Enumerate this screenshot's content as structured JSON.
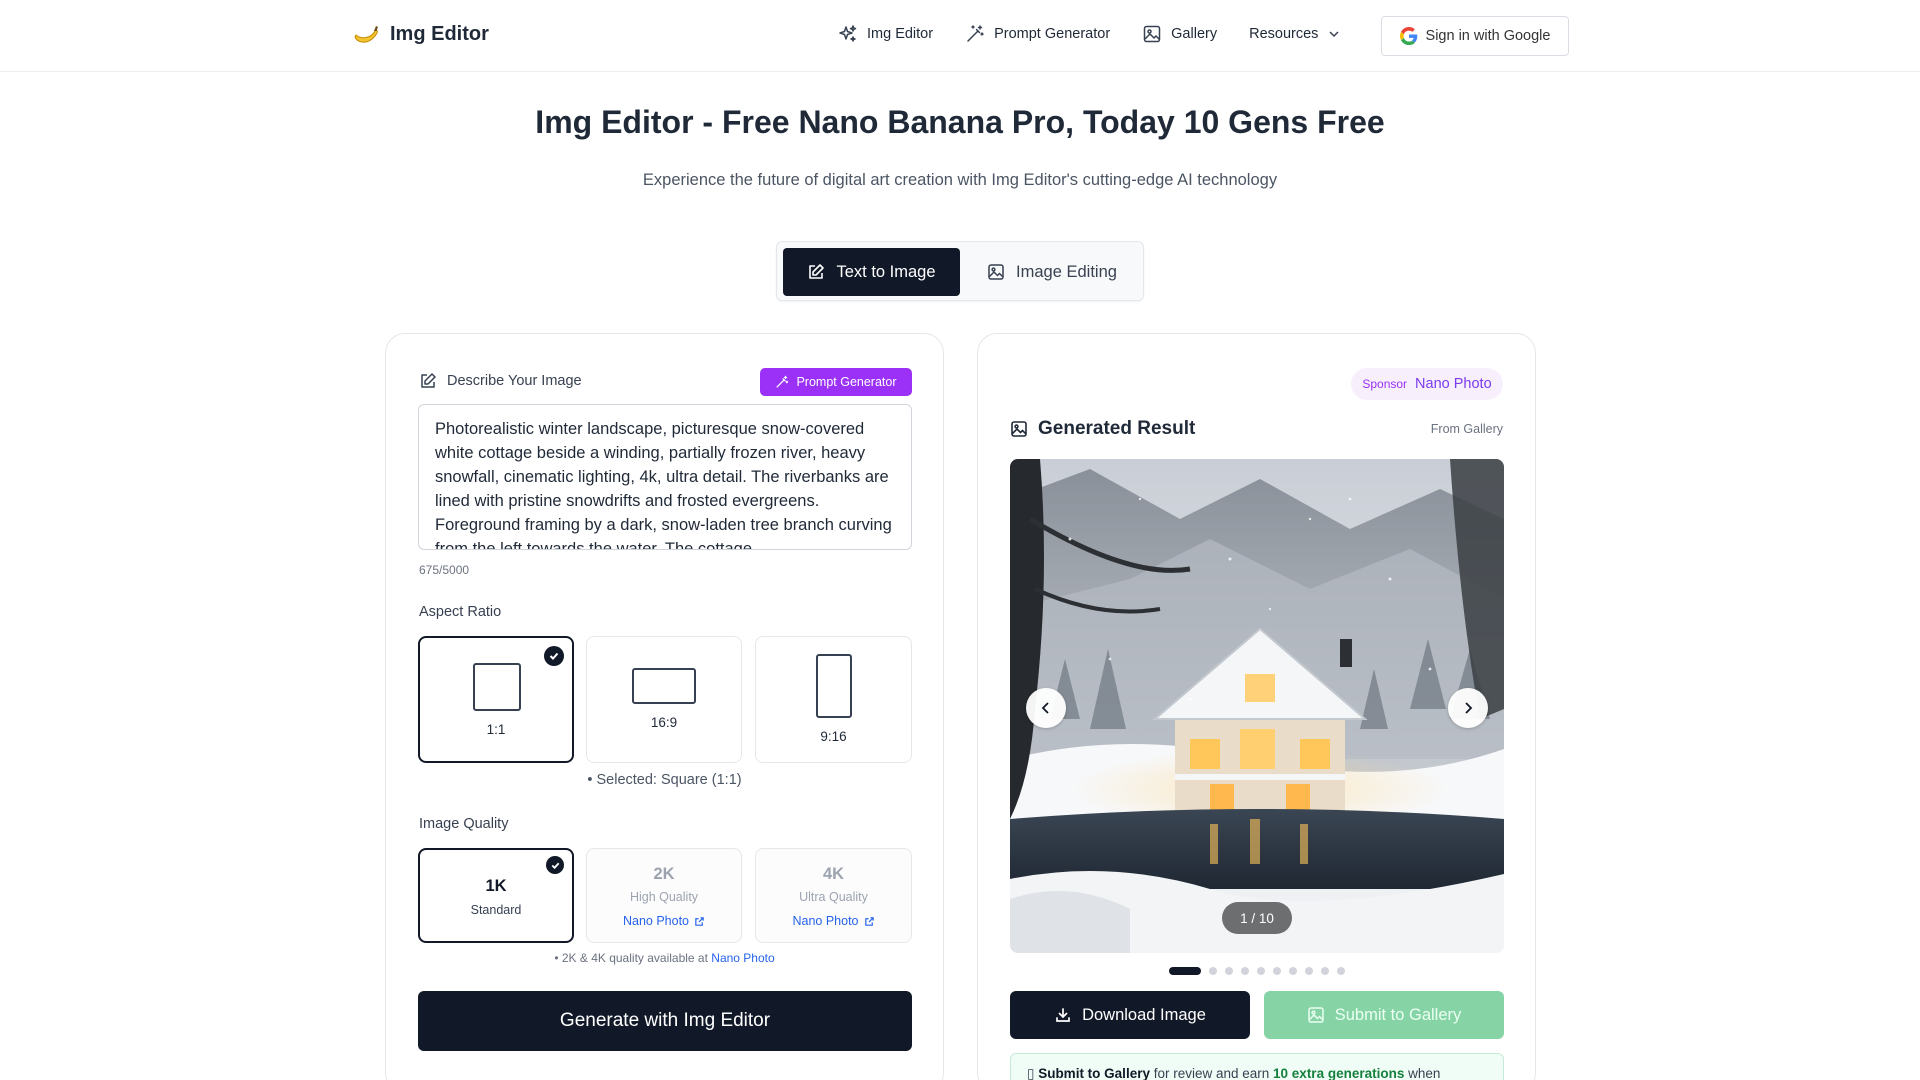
{
  "nav": {
    "brand": "Img Editor",
    "links": [
      {
        "label": "Img Editor",
        "icon": "sparkles-icon"
      },
      {
        "label": "Prompt Generator",
        "icon": "magic-wand-icon"
      },
      {
        "label": "Gallery",
        "icon": "image-icon"
      },
      {
        "label": "Resources",
        "icon": "chevron-down-icon"
      }
    ],
    "signin_label": "Sign in with Google"
  },
  "hero": {
    "title": "Img Editor - Free Nano Banana Pro, Today 10 Gens Free",
    "subtitle": "Experience the future of digital art creation with Img Editor's cutting-edge AI technology"
  },
  "tabs": [
    {
      "label": "Text to Image",
      "active": true
    },
    {
      "label": "Image Editing",
      "active": false
    }
  ],
  "left": {
    "describe_label": "Describe Your Image",
    "prompt_generator_label": "Prompt Generator",
    "prompt_text": "Photorealistic winter landscape, picturesque snow-covered white cottage beside a winding, partially frozen river, heavy snowfall, cinematic lighting, 4k, ultra detail. The riverbanks are lined with pristine snowdrifts and frosted evergreens. Foreground framing by a dark, snow-laden tree branch curving from the left towards the water. The cottage",
    "char_count": "675/5000",
    "aspect_ratio_label": "Aspect Ratio",
    "aspect_ratios": [
      {
        "label": "1:1",
        "selected": true
      },
      {
        "label": "16:9",
        "selected": false
      },
      {
        "label": "9:16",
        "selected": false
      }
    ],
    "aspect_selected_text": "• Selected: Square (1:1)",
    "quality_label": "Image Quality",
    "qualities": [
      {
        "title": "1K",
        "subtitle": "Standard",
        "link": "",
        "selected": true
      },
      {
        "title": "2K",
        "subtitle": "High Quality",
        "link": "Nano Photo",
        "selected": false
      },
      {
        "title": "4K",
        "subtitle": "Ultra Quality",
        "link": "Nano Photo",
        "selected": false
      }
    ],
    "quality_note_prefix": "• 2K & 4K quality available at ",
    "quality_note_link": "Nano Photo",
    "generate_label": "Generate with Img Editor"
  },
  "right": {
    "sponsor_tag": "Sponsor",
    "sponsor_name": "Nano Photo",
    "result_title": "Generated Result",
    "from_gallery": "From Gallery",
    "image_counter": "1 / 10",
    "slide_count": 10,
    "active_slide": 1,
    "download_label": "Download Image",
    "submit_label": "Submit to Gallery",
    "notice": {
      "bold": "Submit to Gallery",
      "middle": " for review and earn ",
      "highlight": "10 extra generations",
      "end": " when"
    }
  },
  "colors": {
    "primary": "#111827",
    "accent_purple": "#9b30f6",
    "link_blue": "#2563eb",
    "submit_green": "#86d4a5"
  }
}
